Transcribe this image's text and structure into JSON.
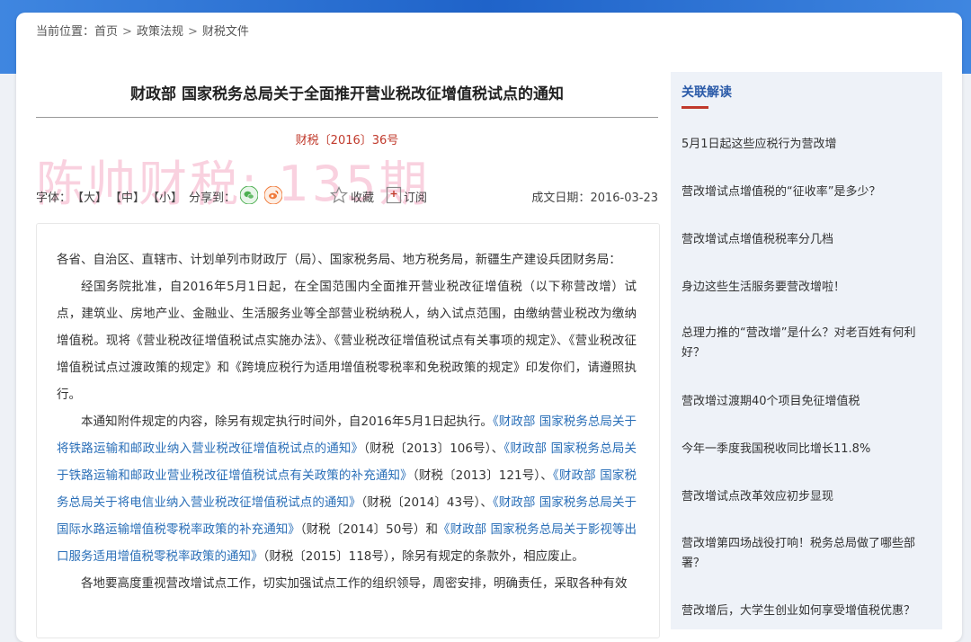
{
  "breadcrumb": {
    "prefix": "当前位置：",
    "home": "首页",
    "section": "政策法规",
    "current": "财税文件",
    "separator": ">"
  },
  "article": {
    "title": "财政部 国家税务总局关于全面推开营业税改征增值税试点的通知",
    "doc_number": "财税〔2016〕36号",
    "watermark": "陈帅财税: 135期",
    "font_label": "字体：",
    "font_large": "【大】",
    "font_medium": "【中】",
    "font_small": "【小】",
    "share_label": "分享到：",
    "favorite_label": "收藏",
    "subscribe_label": "订阅",
    "date_label": "成文日期：",
    "date_value": "2016-03-23",
    "p1": "各省、自治区、直辖市、计划单列市财政厅（局）、国家税务局、地方税务局，新疆生产建设兵团财务局：",
    "p2": "经国务院批准，自2016年5月1日起，在全国范围内全面推开营业税改征增值税（以下称营改增）试点，建筑业、房地产业、金融业、生活服务业等全部营业税纳税人，纳入试点范围，由缴纳营业税改为缴纳增值税。现将《营业税改征增值税试点实施办法》、《营业税改征增值税试点有关事项的规定》、《营业税改征增值税试点过渡政策的规定》和《跨境应税行为适用增值税零税率和免税政策的规定》印发你们，请遵照执行。",
    "p3_start": "本通知附件规定的内容，除另有规定执行时间外，自2016年5月1日起执行。",
    "link1": "《财政部 国家税务总局关于将铁路运输和邮政业纳入营业税改征增值税试点的通知》",
    "ref1": "（财税〔2013〕106号）、",
    "link2": "《财政部 国家税务总局关于铁路运输和邮政业营业税改征增值税试点有关政策的补充通知》",
    "ref2": "（财税〔2013〕121号）、",
    "link3": "《财政部 国家税务总局关于将电信业纳入营业税改征增值税试点的通知》",
    "ref3": "（财税〔2014〕43号）、",
    "link4": "《财政部 国家税务总局关于国际水路运输增值税零税率政策的补充通知》",
    "ref4": "（财税〔2014〕50号）和",
    "link5": "《财政部 国家税务总局关于影视等出口服务适用增值税零税率政策的通知》",
    "ref5": "（财税〔2015〕118号），除另有规定的条款外，相应废止。",
    "p4": "各地要高度重视营改增试点工作，切实加强试点工作的组织领导，周密安排，明确责任，采取各种有效"
  },
  "related": {
    "title": "关联解读",
    "items": [
      "5月1日起这些应税行为营改增",
      "营改增试点增值税的“征收率”是多少？",
      "营改增试点增值税税率分几档",
      "身边这些生活服务要营改增啦！",
      "总理力推的“营改增”是什么？对老百姓有何利好？",
      "营改增过渡期40个项目免征增值税",
      "今年一季度我国税收同比增长11.8%",
      "营改增试点改革效应初步显现",
      "营改增第四场战役打响！税务总局做了哪些部署？",
      "营改增后，大学生创业如何享受增值税优惠？"
    ]
  },
  "colors": {
    "header_blue": "#1f63c9",
    "doc_number_red": "#c0392b",
    "link_blue": "#2a6fb8",
    "related_title_blue": "#2a5aa8",
    "wechat_green": "#4caf50",
    "weibo_orange": "#f07a3a"
  },
  "icons": {
    "wechat": "wechat-icon",
    "weibo": "weibo-icon",
    "favorite": "star-icon",
    "subscribe": "bookmark-plus-icon"
  }
}
